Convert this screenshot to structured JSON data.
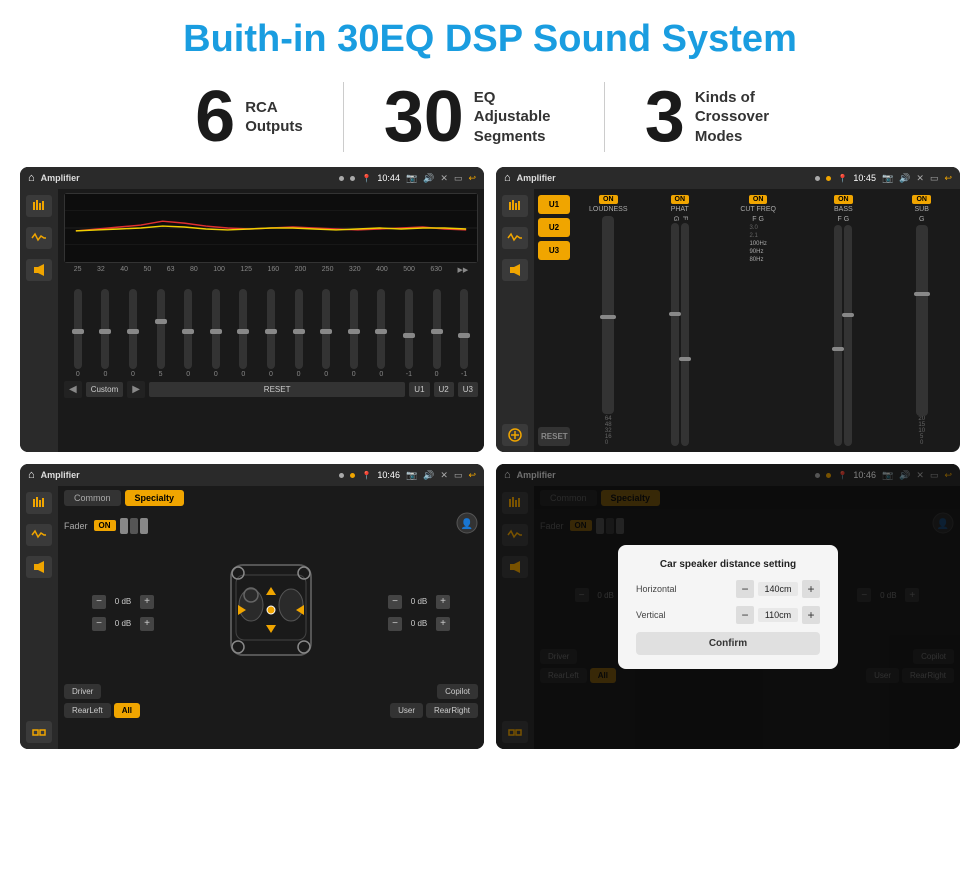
{
  "page": {
    "title": "Buith-in 30EQ DSP Sound System",
    "stats": [
      {
        "number": "6",
        "text": "RCA\nOutputs"
      },
      {
        "number": "30",
        "text": "EQ Adjustable\nSegments"
      },
      {
        "number": "3",
        "text": "Kinds of\nCrossover Modes"
      }
    ]
  },
  "screen1": {
    "topbar": {
      "title": "Amplifier",
      "time": "10:44"
    },
    "freqs": [
      "25",
      "32",
      "40",
      "50",
      "63",
      "80",
      "100",
      "125",
      "160",
      "200",
      "250",
      "320",
      "400",
      "500",
      "630"
    ],
    "vals": [
      "0",
      "0",
      "0",
      "5",
      "0",
      "0",
      "0",
      "0",
      "0",
      "0",
      "0",
      "0",
      "-1",
      "0",
      "-1"
    ],
    "buttons": [
      "Custom",
      "RESET",
      "U1",
      "U2",
      "U3"
    ]
  },
  "screen2": {
    "topbar": {
      "title": "Amplifier",
      "time": "10:45"
    },
    "presets": [
      "U1",
      "U2",
      "U3"
    ],
    "channels": [
      {
        "label": "LOUDNESS",
        "on": true
      },
      {
        "label": "PHAT",
        "on": true
      },
      {
        "label": "CUT FREQ",
        "on": true
      },
      {
        "label": "BASS",
        "on": true
      },
      {
        "label": "SUB",
        "on": true
      }
    ]
  },
  "screen3": {
    "topbar": {
      "title": "Amplifier",
      "time": "10:46"
    },
    "tabs": [
      "Common",
      "Specialty"
    ],
    "fader_label": "Fader",
    "fader_on": "ON",
    "db_values": [
      "0 dB",
      "0 dB",
      "0 dB",
      "0 dB"
    ],
    "bottom_btns": [
      "Driver",
      "RearLeft",
      "All",
      "User",
      "Copilot",
      "RearRight"
    ]
  },
  "screen4": {
    "topbar": {
      "title": "Amplifier",
      "time": "10:46"
    },
    "tabs": [
      "Common",
      "Specialty"
    ],
    "dialog": {
      "title": "Car speaker distance setting",
      "horizontal_label": "Horizontal",
      "horizontal_value": "140cm",
      "vertical_label": "Vertical",
      "vertical_value": "110cm",
      "confirm_label": "Confirm"
    },
    "db_values": [
      "0 dB",
      "0 dB"
    ],
    "bottom_btns": [
      "Driver",
      "RearLeft",
      "All",
      "User",
      "Copilot",
      "RearRight"
    ]
  },
  "icons": {
    "home": "⌂",
    "back": "↩",
    "eq": "≋",
    "wave": "〜",
    "speaker": "◈",
    "settings": "⚙",
    "minus": "−",
    "plus": "+"
  }
}
